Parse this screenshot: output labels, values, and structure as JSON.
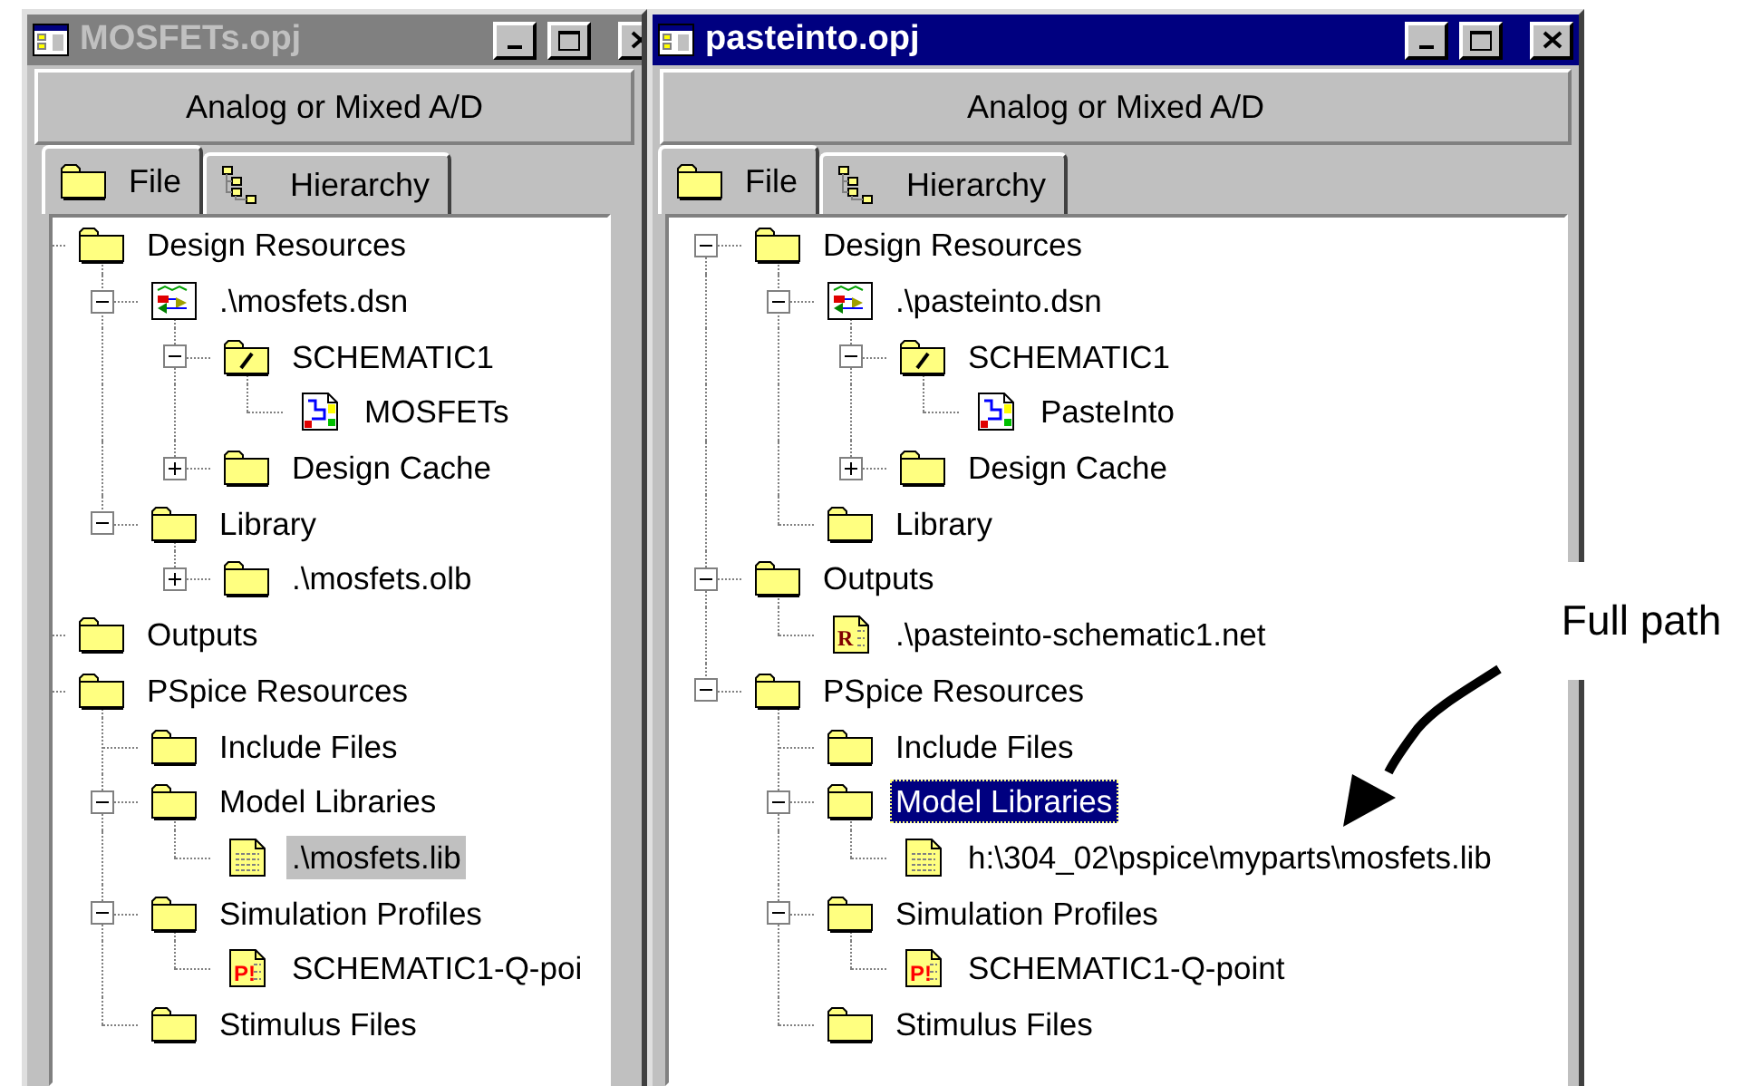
{
  "windows": [
    {
      "title": "MOSFETs.opj",
      "active": false,
      "mode": "Analog or Mixed A/D",
      "tabs": [
        {
          "label": "File",
          "kind": "folder",
          "selected": true
        },
        {
          "label": "Hierarchy",
          "kind": "hierarchy",
          "selected": false
        }
      ],
      "tree": [
        {
          "label": "Design Resources",
          "kind": "folder",
          "selected": false,
          "children": [
            {
              "label": ".\\mosfets.dsn",
              "kind": "design",
              "expanded": true,
              "selected": false,
              "children": [
                {
                  "label": "SCHEMATIC1",
                  "kind": "schematic",
                  "expanded": true,
                  "selected": false,
                  "children": [
                    {
                      "label": "MOSFETs",
                      "kind": "page",
                      "selected": false
                    }
                  ]
                },
                {
                  "label": "Design Cache",
                  "kind": "folder",
                  "expanded": false,
                  "selected": false
                }
              ]
            },
            {
              "label": "Library",
              "kind": "folder",
              "expanded": true,
              "selected": false,
              "children": [
                {
                  "label": ".\\mosfets.olb",
                  "kind": "folder",
                  "expanded": false,
                  "selected": false
                }
              ]
            }
          ]
        },
        {
          "label": "Outputs",
          "kind": "folder",
          "selected": false
        },
        {
          "label": "PSpice Resources",
          "kind": "folder",
          "selected": false,
          "children": [
            {
              "label": "Include Files",
              "kind": "folder",
              "selected": false
            },
            {
              "label": "Model Libraries",
              "kind": "folder",
              "expanded": true,
              "selected": false,
              "children": [
                {
                  "label": ".\\mosfets.lib",
                  "kind": "library",
                  "selected": true
                }
              ]
            },
            {
              "label": "Simulation Profiles",
              "kind": "folder",
              "expanded": true,
              "selected": false,
              "children": [
                {
                  "label": "SCHEMATIC1-Q-poi",
                  "kind": "profile",
                  "icon_text": "P!",
                  "selected": false
                }
              ]
            },
            {
              "label": "Stimulus Files",
              "kind": "folder",
              "selected": false
            }
          ]
        }
      ]
    },
    {
      "title": "pasteinto.opj",
      "active": true,
      "mode": "Analog or Mixed A/D",
      "tabs": [
        {
          "label": "File",
          "kind": "folder",
          "selected": true
        },
        {
          "label": "Hierarchy",
          "kind": "hierarchy",
          "selected": false
        }
      ],
      "tree": [
        {
          "label": "Design Resources",
          "kind": "folder",
          "expanded": true,
          "selected": false,
          "children": [
            {
              "label": ".\\pasteinto.dsn",
              "kind": "design",
              "expanded": true,
              "selected": false,
              "children": [
                {
                  "label": "SCHEMATIC1",
                  "kind": "schematic",
                  "expanded": true,
                  "selected": false,
                  "children": [
                    {
                      "label": "PasteInto",
                      "kind": "page",
                      "selected": false
                    }
                  ]
                },
                {
                  "label": "Design Cache",
                  "kind": "folder",
                  "expanded": false,
                  "selected": false
                }
              ]
            },
            {
              "label": "Library",
              "kind": "folder",
              "selected": false
            }
          ]
        },
        {
          "label": "Outputs",
          "kind": "folder",
          "expanded": true,
          "selected": false,
          "children": [
            {
              "label": ".\\pasteinto-schematic1.net",
              "kind": "netlist",
              "icon_text": "R",
              "selected": false
            }
          ]
        },
        {
          "label": "PSpice Resources",
          "kind": "folder",
          "expanded": true,
          "selected": false,
          "children": [
            {
              "label": "Include Files",
              "kind": "folder",
              "selected": false
            },
            {
              "label": "Model Libraries",
              "kind": "folder",
              "expanded": true,
              "selected": true,
              "children": [
                {
                  "label": "h:\\304_02\\pspice\\myparts\\mosfets.lib",
                  "kind": "library",
                  "selected": false
                }
              ]
            },
            {
              "label": "Simulation Profiles",
              "kind": "folder",
              "expanded": true,
              "selected": false,
              "children": [
                {
                  "label": "SCHEMATIC1-Q-point",
                  "kind": "profile",
                  "icon_text": "P!",
                  "selected": false
                }
              ]
            },
            {
              "label": "Stimulus Files",
              "kind": "folder",
              "selected": false
            }
          ]
        }
      ]
    }
  ],
  "annotation": {
    "text": "Full path"
  }
}
